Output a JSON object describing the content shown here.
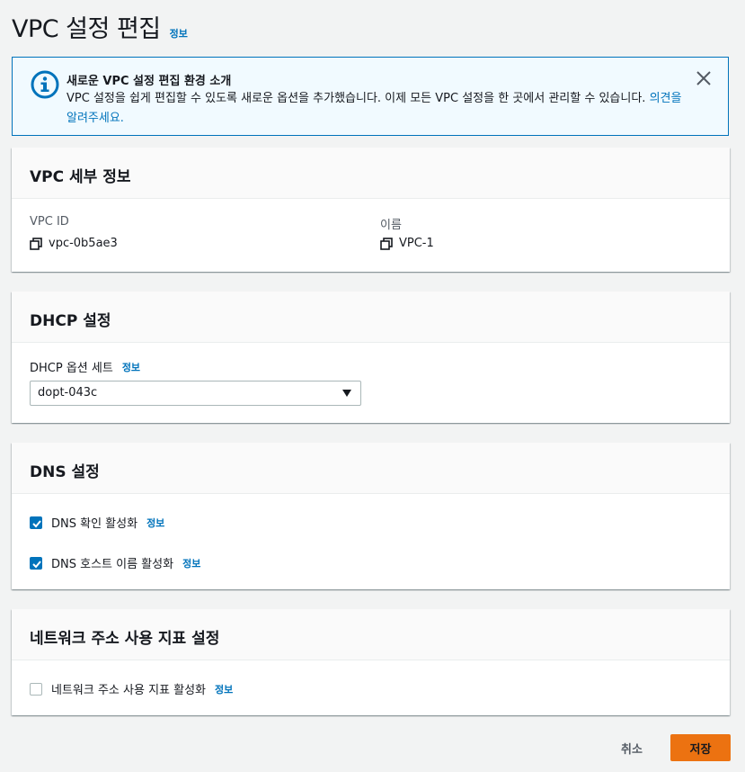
{
  "page": {
    "title": "VPC 설정 편집",
    "info_label": "정보"
  },
  "flash": {
    "title": "새로운 VPC 설정 편집 환경 소개",
    "body": "VPC 설정을 쉽게 편집할 수 있도록 새로운 옵션을 추가했습니다. 이제 모든 VPC 설정을 한 곳에서 관리할 수 있습니다.",
    "feedback_link": "의견을 알려주세요.",
    "icon": "info-icon"
  },
  "vpc_details": {
    "heading": "VPC 세부 정보",
    "vpc_id_label": "VPC ID",
    "vpc_id_value": "vpc-0b5ae3",
    "name_label": "이름",
    "name_value": "VPC-1"
  },
  "dhcp": {
    "heading": "DHCP 설정",
    "option_set_label": "DHCP 옵션 세트",
    "info_label": "정보",
    "selected_value": "dopt-043c"
  },
  "dns": {
    "heading": "DNS 설정",
    "resolution_label": "DNS 확인 활성화",
    "resolution_checked": true,
    "hostnames_label": "DNS 호스트 이름 활성화",
    "hostnames_checked": true,
    "info_label": "정보"
  },
  "network_metrics": {
    "heading": "네트워크 주소 사용 지표 설정",
    "enable_label": "네트워크 주소 사용 지표 활성화",
    "enable_checked": false,
    "info_label": "정보"
  },
  "actions": {
    "cancel_label": "취소",
    "save_label": "저장"
  },
  "colors": {
    "accent": "#0073bb",
    "primary_button": "#ec7211",
    "flash_bg": "#f1faff"
  }
}
